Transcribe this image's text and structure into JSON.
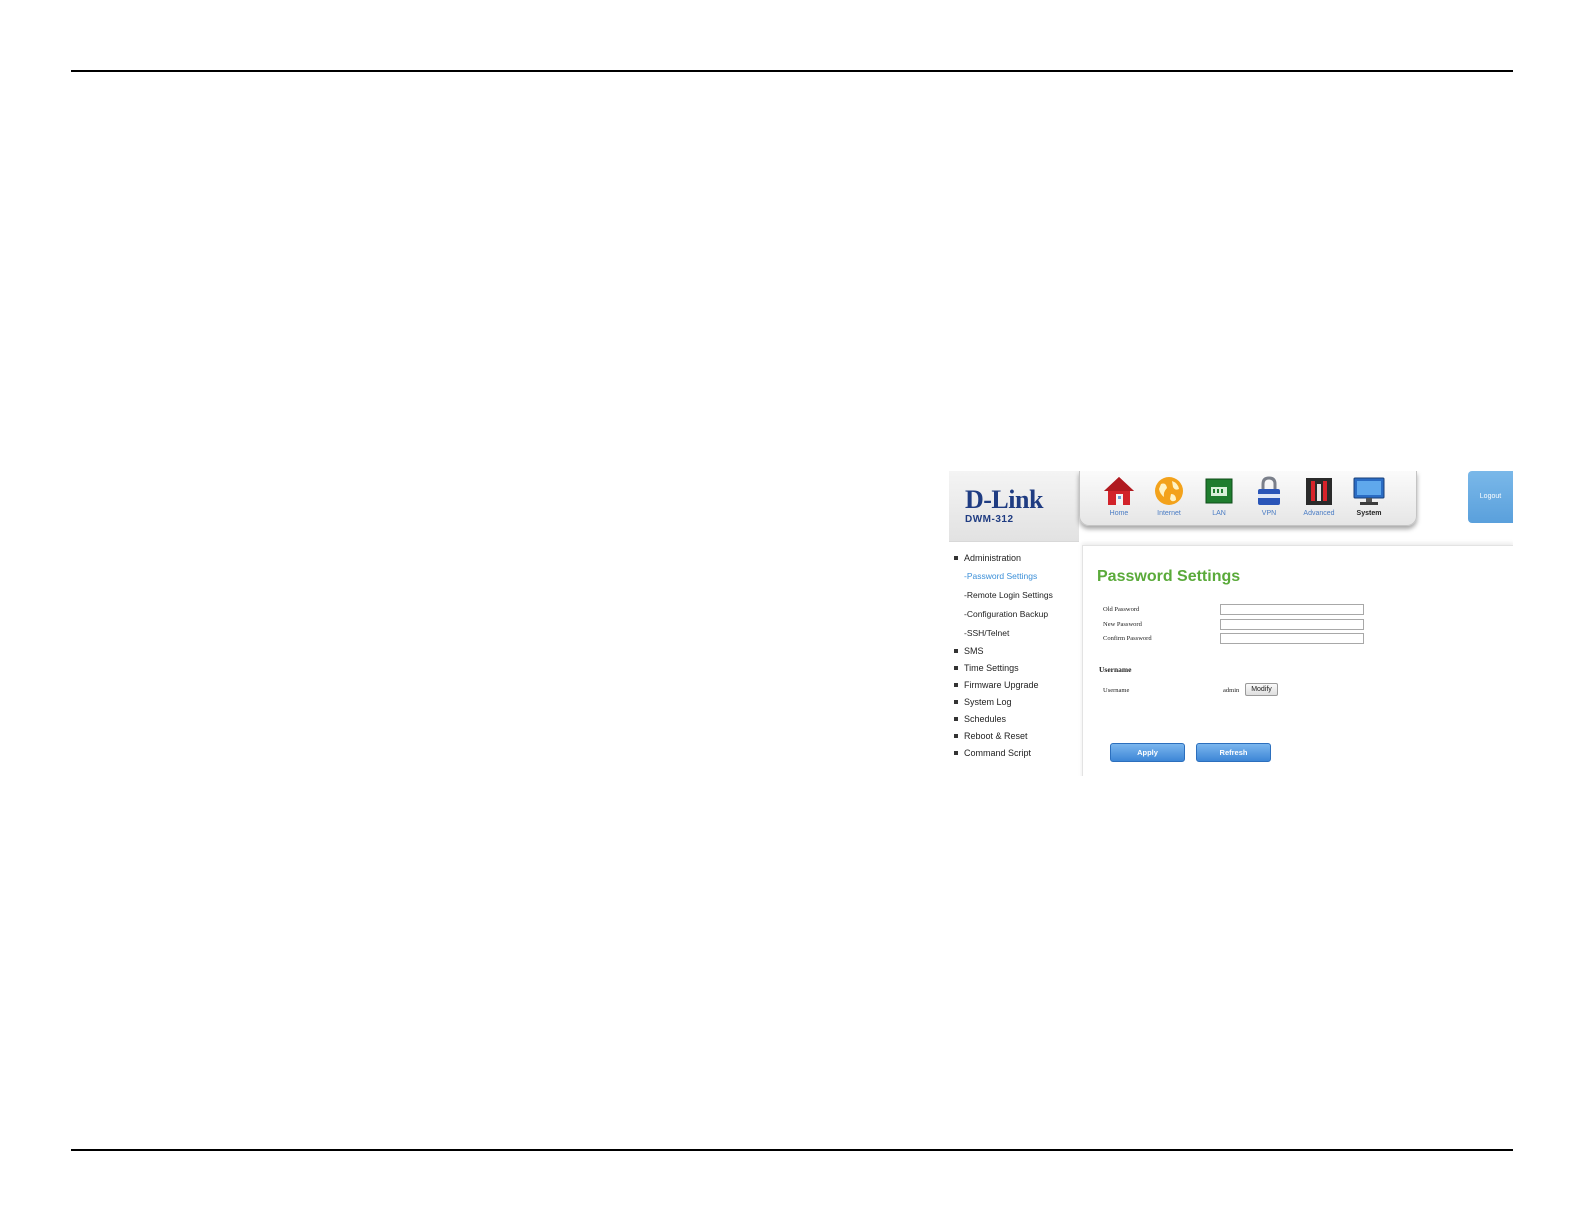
{
  "brand": {
    "logo": "D-Link",
    "model": "DWM-312"
  },
  "nav": {
    "items": [
      {
        "label": "Home",
        "icon": "home-icon"
      },
      {
        "label": "Internet",
        "icon": "internet-icon"
      },
      {
        "label": "LAN",
        "icon": "lan-icon"
      },
      {
        "label": "VPN",
        "icon": "vpn-icon"
      },
      {
        "label": "Advanced",
        "icon": "advanced-icon"
      },
      {
        "label": "System",
        "icon": "system-icon"
      }
    ],
    "active": "System",
    "logout": "Logout"
  },
  "sidebar": {
    "items": [
      {
        "label": "Administration"
      },
      {
        "label": "SMS"
      },
      {
        "label": "Time Settings"
      },
      {
        "label": "Firmware Upgrade"
      },
      {
        "label": "System Log"
      },
      {
        "label": "Schedules"
      },
      {
        "label": "Reboot & Reset"
      },
      {
        "label": "Command Script"
      }
    ],
    "subitems": [
      {
        "label": "-Password Settings"
      },
      {
        "label": "-Remote Login Settings"
      },
      {
        "label": "-Configuration Backup"
      },
      {
        "label": "-SSH/Telnet"
      }
    ]
  },
  "main": {
    "title": "Password Settings",
    "fields": [
      {
        "label": "Old Password",
        "value": ""
      },
      {
        "label": "New Password",
        "value": ""
      },
      {
        "label": "Confirm Password",
        "value": ""
      }
    ],
    "username_section": {
      "heading": "Username",
      "label": "Username",
      "value": "admin",
      "modify_label": "Modify"
    },
    "apply_label": "Apply",
    "refresh_label": "Refresh"
  },
  "colors": {
    "accent_green": "#5aaa3a",
    "link_blue": "#3b8fd8",
    "button_blue": "#3d86d6",
    "brand_navy": "#1f3c82"
  }
}
